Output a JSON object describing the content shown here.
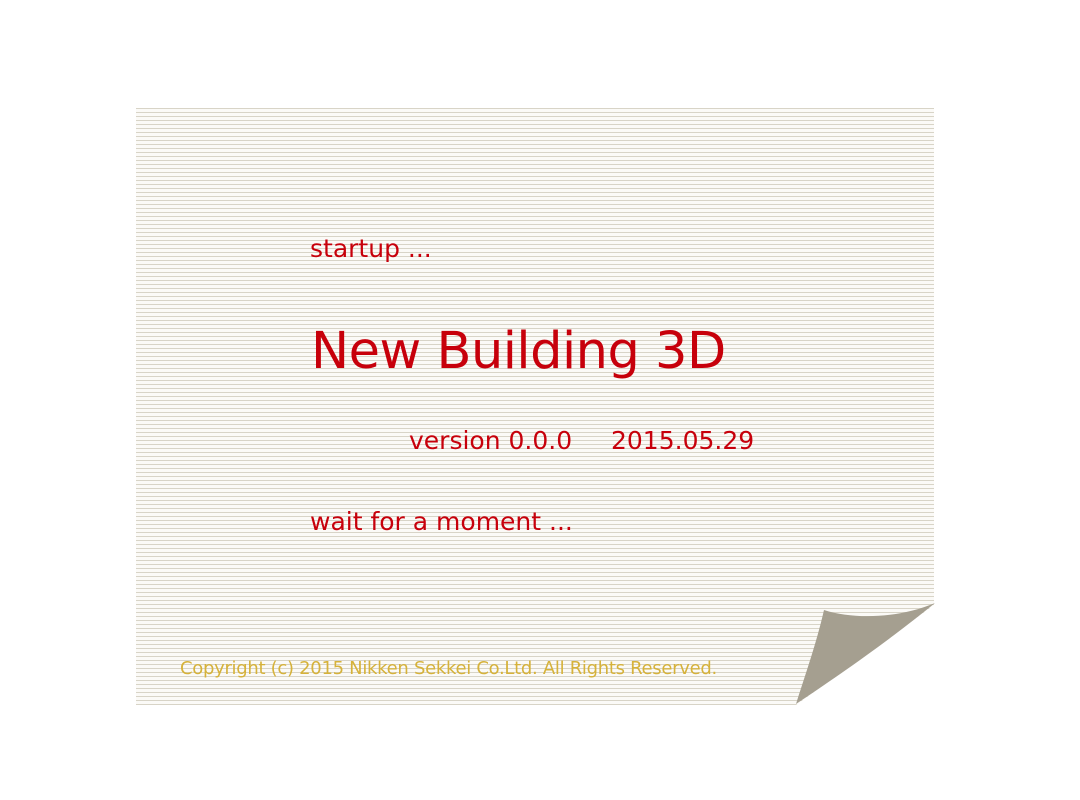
{
  "splash": {
    "startup_text": "startup ...",
    "title": "New Building 3D",
    "version": "version 0.0.0",
    "date": "2015.05.29",
    "status_text": "wait for a moment ...",
    "copyright": "Copyright (c) 2015 Nikken Sekkei Co.Ltd. All Rights Reserved."
  },
  "colors": {
    "accent": "#c7000b",
    "copyright": "#d6b23a",
    "stripe": "#d8d4c7",
    "page_curl": "#a59f90"
  },
  "icons": {
    "corner": "page-curl-icon"
  }
}
